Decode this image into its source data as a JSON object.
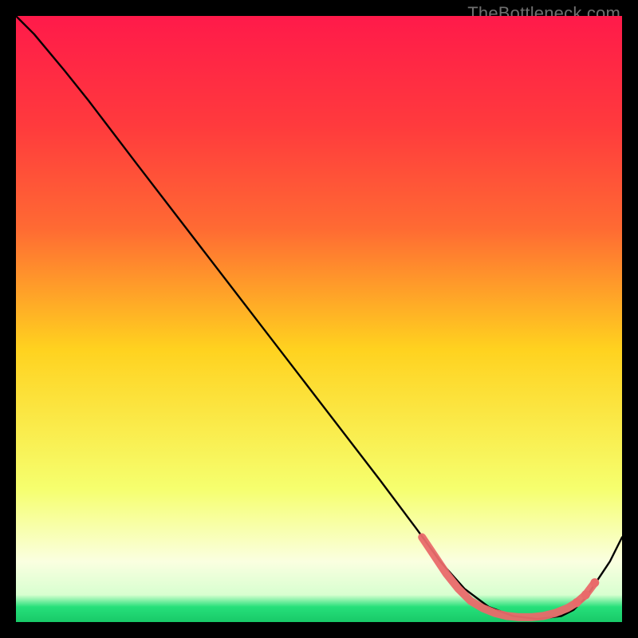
{
  "watermark": "TheBottleneck.com",
  "colors": {
    "gradient_top": "#ff1a4a",
    "gradient_upper": "#ff6a33",
    "gradient_mid": "#ffd21f",
    "gradient_lower": "#f6ff6e",
    "gradient_pale": "#faffe0",
    "gradient_green": "#26e07a",
    "curve": "#000000",
    "marker": "#e96a6a",
    "frame": "#000000"
  },
  "chart_data": {
    "type": "line",
    "title": "",
    "xlabel": "",
    "ylabel": "",
    "xlim": [
      0,
      100
    ],
    "ylim": [
      0,
      100
    ],
    "series": [
      {
        "name": "bottleneck-curve",
        "x": [
          0,
          3,
          8,
          12,
          20,
          30,
          40,
          50,
          60,
          66,
          70,
          74,
          78,
          82,
          86,
          90,
          92,
          94,
          96,
          98,
          100
        ],
        "y": [
          100,
          97,
          91,
          86,
          75.5,
          62.5,
          49.5,
          36.5,
          23.5,
          15.5,
          10,
          5.5,
          2.5,
          1,
          0.5,
          1,
          2,
          4,
          7,
          10,
          14
        ]
      }
    ],
    "markers": {
      "name": "highlight-band",
      "x": [
        67,
        69,
        71,
        73,
        75,
        77,
        79,
        81,
        83,
        85,
        87,
        89,
        91,
        92.5,
        94,
        95.5
      ],
      "y": [
        14,
        11,
        8,
        5.5,
        3.5,
        2.3,
        1.5,
        1,
        0.8,
        0.8,
        1,
        1.5,
        2.3,
        3.2,
        4.5,
        6.5
      ]
    }
  }
}
